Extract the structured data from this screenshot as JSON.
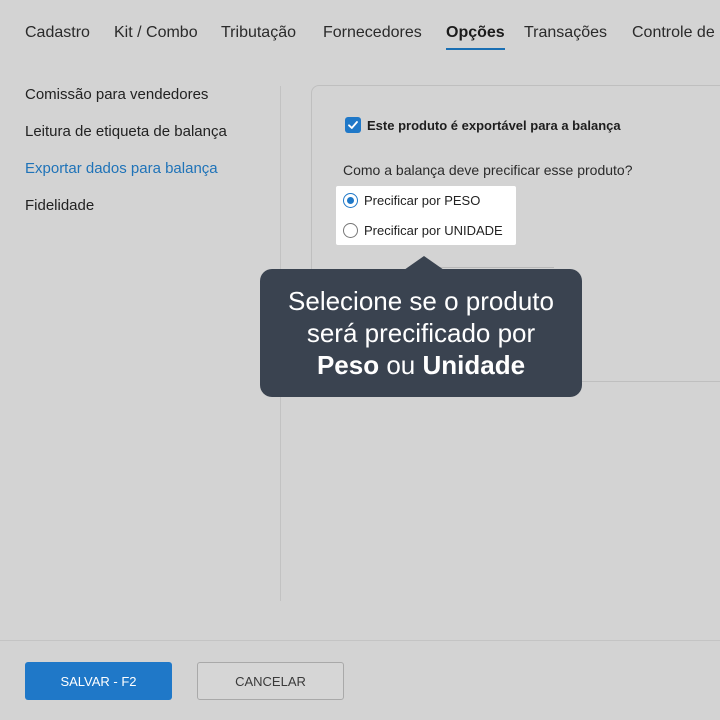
{
  "tabs": [
    {
      "label": "Cadastro",
      "active": false
    },
    {
      "label": "Kit / Combo",
      "active": false
    },
    {
      "label": "Tributação",
      "active": false
    },
    {
      "label": "Fornecedores",
      "active": false
    },
    {
      "label": "Opções",
      "active": true
    },
    {
      "label": "Transações",
      "active": false
    },
    {
      "label": "Controle de",
      "active": false
    }
  ],
  "sidebar": {
    "items": [
      {
        "label": "Comissão para vendedores",
        "active": false
      },
      {
        "label": "Leitura de etiqueta de balança",
        "active": false
      },
      {
        "label": "Exportar dados para balança",
        "active": true
      },
      {
        "label": "Fidelidade",
        "active": false
      }
    ]
  },
  "panel": {
    "export_checkbox": {
      "label": "Este produto é exportável para a balança",
      "checked": true
    },
    "question": "Como a balança deve precificar esse produto?",
    "options": [
      {
        "label": "Precificar por PESO",
        "checked": true
      },
      {
        "label": "Precificar por UNIDADE",
        "checked": false
      }
    ]
  },
  "tooltip": {
    "line1": "Selecione se o produto",
    "line2": "será precificado por",
    "bold1": "Peso",
    "middle": "ou",
    "bold2": "Unidade"
  },
  "footer": {
    "save_label": "SALVAR - F2",
    "cancel_label": "CANCELAR"
  },
  "colors": {
    "accent": "#1f78c8",
    "tooltip_bg": "#3a4350",
    "background": "#d3d3d3"
  }
}
